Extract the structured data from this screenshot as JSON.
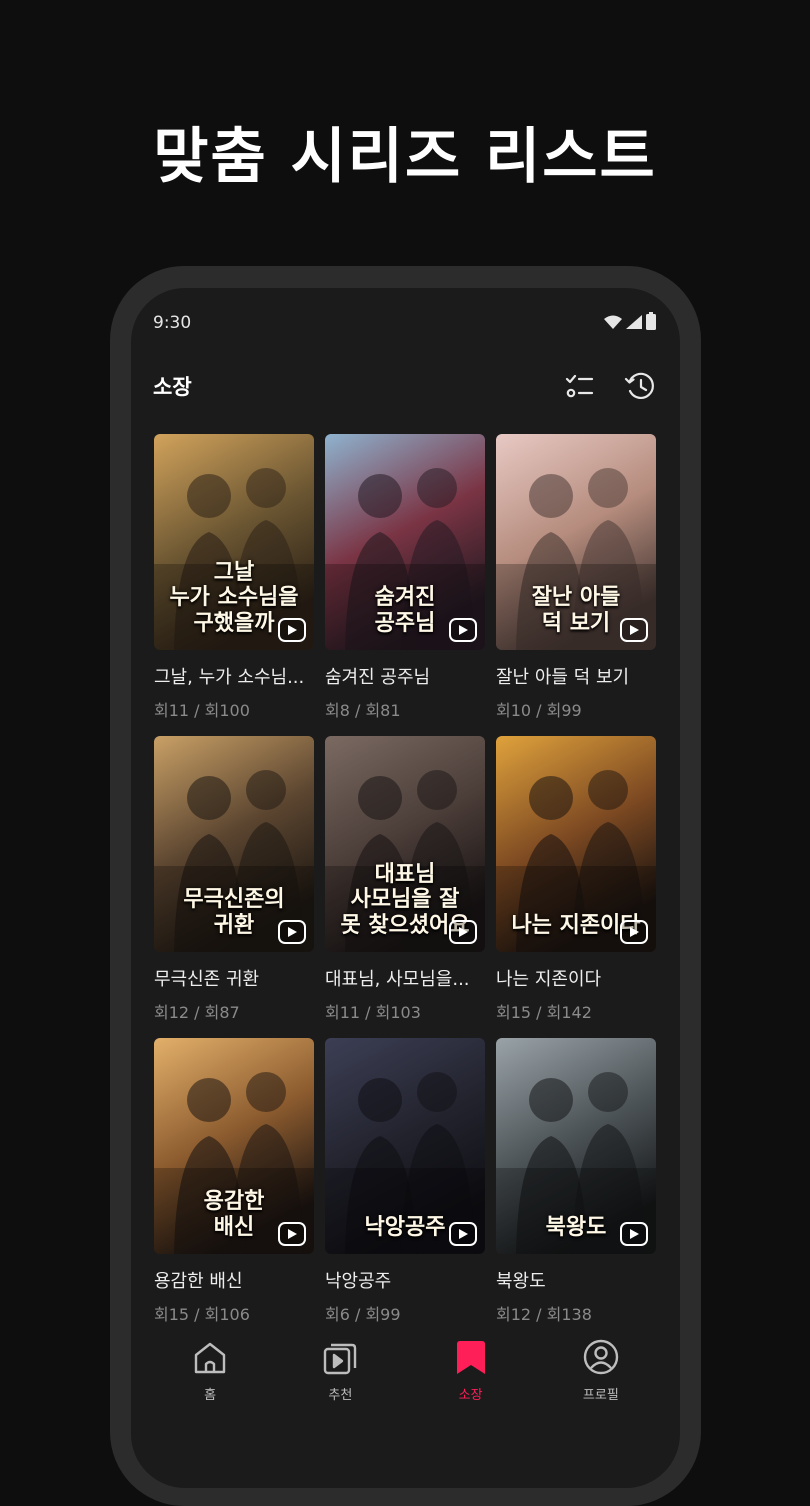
{
  "promo": {
    "headline": "맞춤 시리즈 리스트"
  },
  "status_bar": {
    "time": "9:30"
  },
  "header": {
    "title": "소장",
    "icons": [
      "checklist-icon",
      "history-icon"
    ]
  },
  "series": [
    {
      "name": "그날, 누가 소수님...",
      "poster_text": "그날\n누가 소수님을\n구했을까",
      "episodes": "회11 / 회100",
      "colors": [
        "#d2a35c",
        "#6b5632",
        "#2d2217"
      ]
    },
    {
      "name": "숨겨진 공주님",
      "poster_text": "숨겨진\n공주님",
      "episodes": "회8 / 회81",
      "colors": [
        "#8fb3cf",
        "#7a3444",
        "#241a22"
      ]
    },
    {
      "name": "잘난 아들 덕 보기",
      "poster_text": "잘난 아들\n덕 보기",
      "episodes": "회10 / 회99",
      "colors": [
        "#e8c9c4",
        "#b58c7d",
        "#4a3a36"
      ]
    },
    {
      "name": "무극신존 귀환",
      "poster_text": "무극신존의\n귀환",
      "episodes": "회12 / 회87",
      "colors": [
        "#c9a066",
        "#5b4530",
        "#1e1812"
      ]
    },
    {
      "name": "대표님, 사모님을...",
      "poster_text": "대표님\n사모님을 잘\n못 찾으셨어요",
      "episodes": "회11 / 회103",
      "colors": [
        "#7a6a62",
        "#4b3d38",
        "#1a1516"
      ]
    },
    {
      "name": "나는 지존이다",
      "poster_text": "나는 지존이다",
      "episodes": "회15 / 회142",
      "colors": [
        "#e0a23c",
        "#7e4a22",
        "#1c1410"
      ]
    },
    {
      "name": "용감한 배신",
      "poster_text": "용감한\n배신",
      "episodes": "회15 / 회106",
      "colors": [
        "#e3b06a",
        "#8a5a2e",
        "#1d1512"
      ]
    },
    {
      "name": "낙앙공주",
      "poster_text": "낙앙공주",
      "episodes": "회6 / 회99",
      "colors": [
        "#3c3f55",
        "#23232e",
        "#0f0f14"
      ]
    },
    {
      "name": "북왕도",
      "poster_text": "북왕도",
      "episodes": "회12 / 회138",
      "colors": [
        "#9aa3a8",
        "#4d5458",
        "#161819"
      ]
    }
  ],
  "nav": [
    {
      "label": "홈",
      "icon": "home-icon",
      "active": false
    },
    {
      "label": "추천",
      "icon": "recommend-play-icon",
      "active": false
    },
    {
      "label": "소장",
      "icon": "bookmark-icon",
      "active": true
    },
    {
      "label": "프로필",
      "icon": "profile-icon",
      "active": false
    }
  ],
  "colors": {
    "accent": "#ff1f58",
    "background": "#0e0e0e",
    "screen": "#1b1b1c",
    "muted_text": "#8a8a8a"
  }
}
